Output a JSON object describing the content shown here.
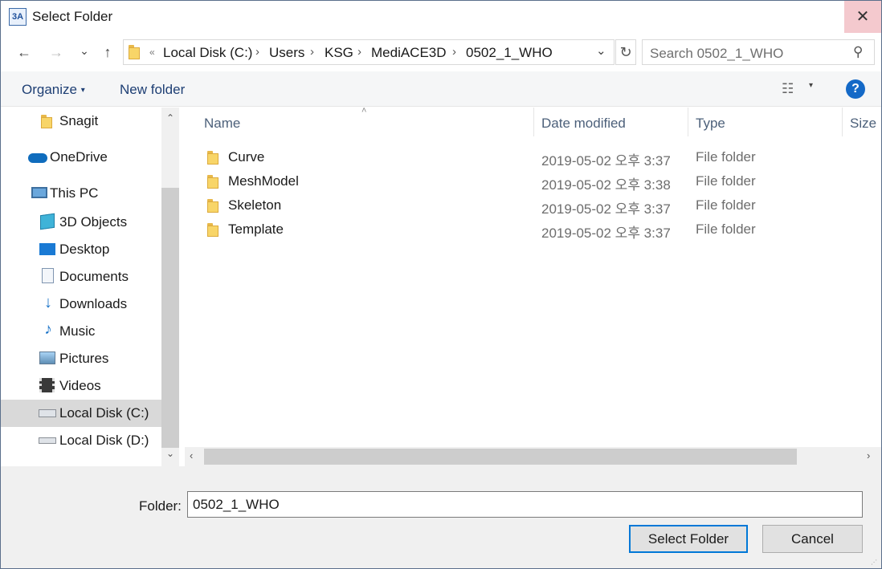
{
  "window": {
    "title": "Select Folder",
    "app_icon_text": "3A",
    "close_glyph": "✕"
  },
  "nav": {
    "back_glyph": "←",
    "forward_glyph": "→",
    "recent_glyph": "⌄",
    "up_glyph": "↑",
    "refresh_glyph": "↻",
    "address_overflow": "«",
    "breadcrumbs": [
      "Local Disk (C:)",
      "Users",
      "KSG",
      "MediACE3D",
      "0502_1_WHO"
    ],
    "crumb_sep": "›",
    "address_dropdown": "⌄",
    "search_placeholder": "Search 0502_1_WHO",
    "search_glyph": "⚲"
  },
  "commands": {
    "organize": "Organize",
    "organize_caret": "▾",
    "new_folder": "New folder",
    "view_glyph": "☷",
    "view_caret": "▾",
    "help_glyph": "?"
  },
  "sidebar": {
    "items": [
      {
        "label": "Snagit",
        "icon": "folder-icon"
      },
      {
        "label": "OneDrive",
        "icon": "onedrive-icon"
      },
      {
        "label": "This PC",
        "icon": "computer-icon"
      },
      {
        "label": "3D Objects",
        "icon": "cube-icon"
      },
      {
        "label": "Desktop",
        "icon": "desktop-icon"
      },
      {
        "label": "Documents",
        "icon": "documents-icon"
      },
      {
        "label": "Downloads",
        "icon": "download-icon"
      },
      {
        "label": "Music",
        "icon": "music-icon"
      },
      {
        "label": "Pictures",
        "icon": "pictures-icon"
      },
      {
        "label": "Videos",
        "icon": "videos-icon"
      },
      {
        "label": "Local Disk (C:)",
        "icon": "windows-drive-icon",
        "selected": true
      },
      {
        "label": "Local Disk (D:)",
        "icon": "drive-icon"
      }
    ],
    "scroll_up": "⌃",
    "scroll_down": "⌄"
  },
  "list": {
    "columns": [
      "Name",
      "Date modified",
      "Type",
      "Size"
    ],
    "sort_caret": "˄",
    "rows": [
      {
        "name": "Curve",
        "date": "2019-05-02 오후 3:37",
        "type": "File folder"
      },
      {
        "name": "MeshModel",
        "date": "2019-05-02 오후 3:38",
        "type": "File folder"
      },
      {
        "name": "Skeleton",
        "date": "2019-05-02 오후 3:37",
        "type": "File folder"
      },
      {
        "name": "Template",
        "date": "2019-05-02 오후 3:37",
        "type": "File folder"
      }
    ],
    "hscroll_left": "‹",
    "hscroll_right": "›"
  },
  "footer": {
    "folder_label": "Folder:",
    "folder_value": "0502_1_WHO",
    "select_button": "Select Folder",
    "cancel_button": "Cancel",
    "resize_grip": "⋰"
  },
  "colors": {
    "accent": "#0078d7",
    "help": "#1469c7",
    "close_hover": "#f4c9ce",
    "folder": "#f8d568"
  }
}
